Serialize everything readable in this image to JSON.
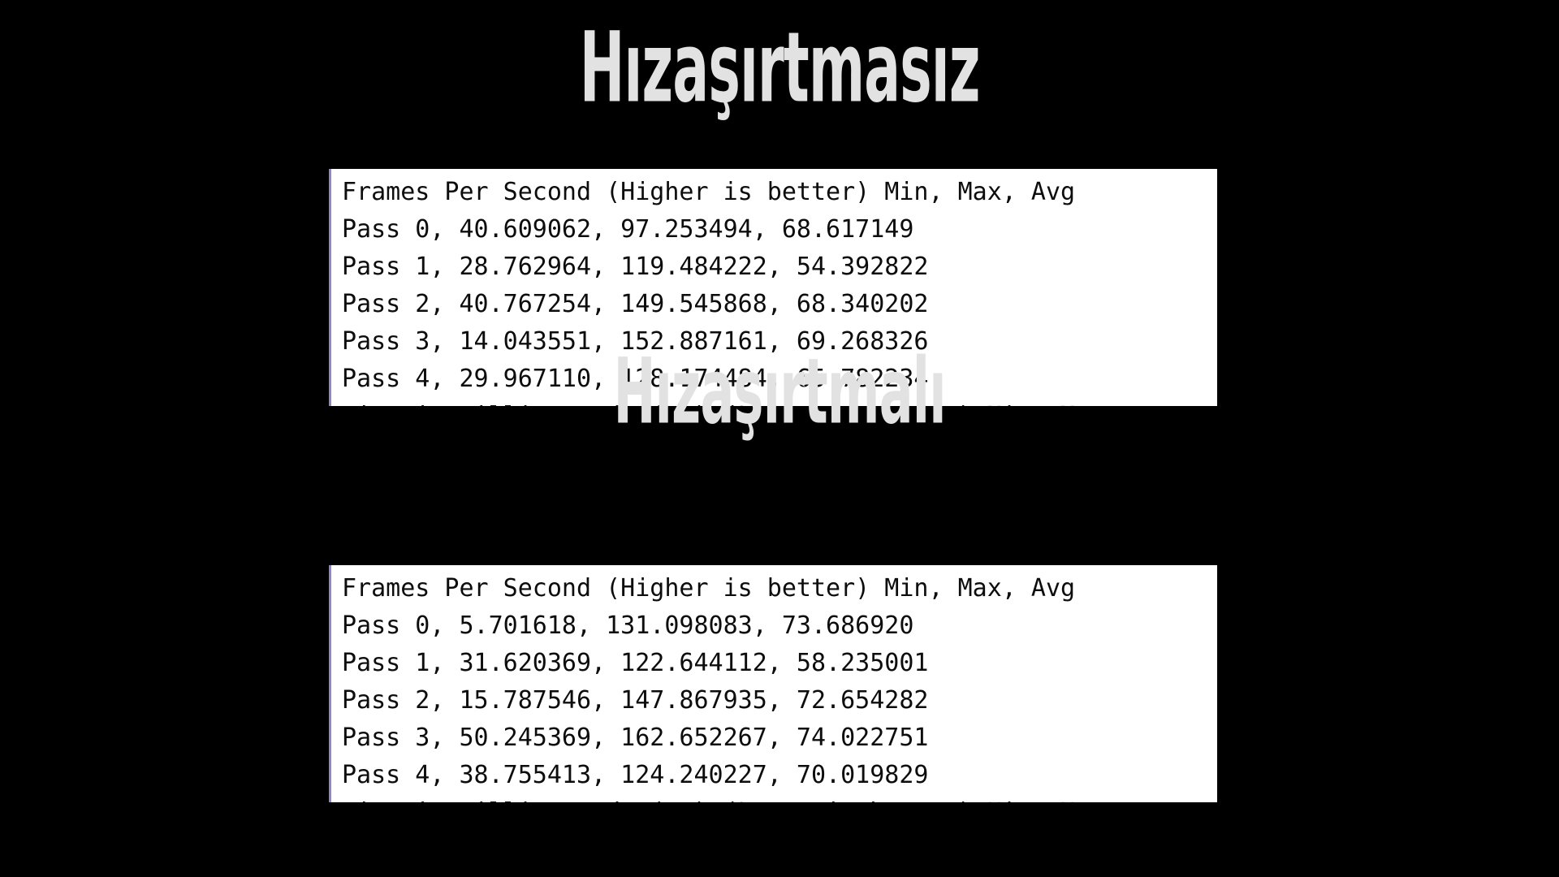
{
  "background_color": "#000000",
  "sections": [
    {
      "title": "Hızaşırtmasız",
      "console": {
        "header": "Frames Per Second (Higher is better) Min, Max, Avg",
        "rows": [
          "Pass 0, 40.609062, 97.253494, 68.617149",
          "Pass 1, 28.762964, 119.484222, 54.392822",
          "Pass 2, 40.767254, 149.545868, 68.340202",
          "Pass 3, 14.043551, 152.887161, 69.268326",
          "Pass 4, 29.967110, 128.174484, 65.782234"
        ],
        "clipped_line": "Time in milliseconds (ms) (Lower is better) Min, M"
      }
    },
    {
      "title": "Hızaşırtmalı",
      "console": {
        "header": "Frames Per Second (Higher is better) Min, Max, Avg",
        "rows": [
          "Pass 0, 5.701618, 131.098083, 73.686920",
          "Pass 1, 31.620369, 122.644112, 58.235001",
          "Pass 2, 15.787546, 147.867935, 72.654282",
          "Pass 3, 50.245369, 162.652267, 74.022751",
          "Pass 4, 38.755413, 124.240227, 70.019829"
        ],
        "clipped_line": "Time in milliseconds (ms) (Lower is better) Min, M"
      }
    }
  ],
  "colors": {
    "title_text": "#e2e2e2",
    "console_background": "#ffffff",
    "console_text": "#0d0d0d",
    "console_border": "#8f86c7"
  }
}
